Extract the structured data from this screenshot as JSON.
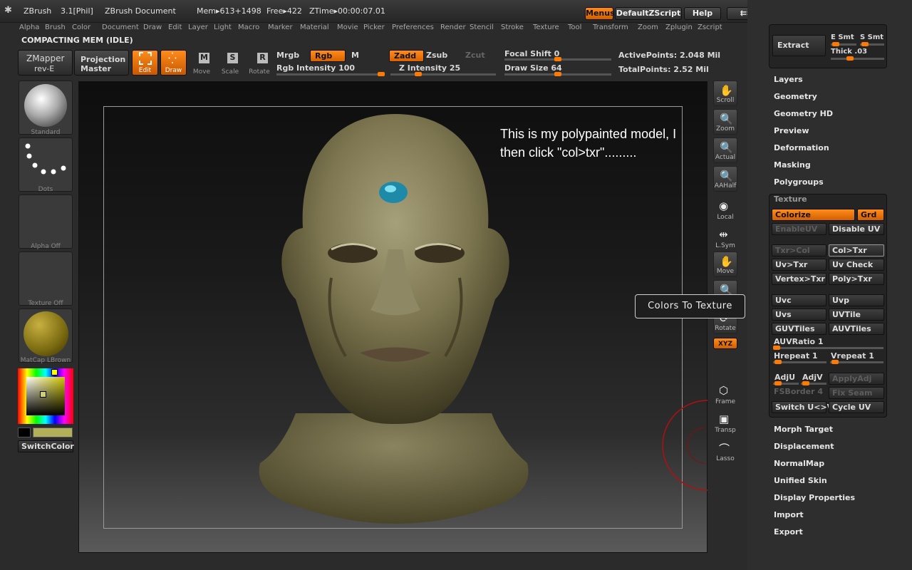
{
  "titlebar": {
    "app": "ZBrush",
    "version": "3.1[Phil]",
    "document": "ZBrush Document",
    "mem": "Mem▸613+1498",
    "free": "Free▸422",
    "ztime": "ZTime▸00:00:07.01",
    "menus_btn": "Menus",
    "script_btn": "DefaultZScript",
    "help_btn": "Help"
  },
  "menubar": [
    "Alpha",
    "Brush",
    "Color",
    "Document",
    "Draw",
    "Edit",
    "Layer",
    "Light",
    "Macro",
    "Marker",
    "Material",
    "Movie",
    "Picker",
    "Preferences",
    "Render",
    "Stencil",
    "Stroke",
    "Texture",
    "Tool",
    "Transform",
    "Zoom",
    "Zplugin",
    "Zscript"
  ],
  "status": "COMPACTING MEM (IDLE)",
  "toolbar": {
    "zmapper": "ZMapper",
    "zmapper_sub": "rev-E",
    "projection": "Projection",
    "projection_sub": "Master",
    "edit": "Edit",
    "draw": "Draw",
    "move": "Move",
    "scale": "Scale",
    "rotate": "Rotate",
    "mrgb": "Mrgb",
    "rgb": "Rgb",
    "m": "M",
    "rgb_intensity": "Rgb Intensity 100",
    "zadd": "Zadd",
    "zsub": "Zsub",
    "zcut": "Zcut",
    "z_intensity": "Z Intensity 25",
    "focal_shift": "Focal Shift 0",
    "draw_size": "Draw Size 64",
    "active_points": "ActivePoints: 2.048 Mil",
    "total_points": "TotalPoints: 2.52 Mil"
  },
  "leftpanel": {
    "standard": "Standard",
    "dots": "Dots",
    "alpha": "Alpha Off",
    "texture": "Texture Off",
    "matcap": "MatCap LBrown",
    "switchcolor": "SwitchColor"
  },
  "rightbar": [
    "Scroll",
    "Zoom",
    "Actual",
    "AAHalf",
    "Local",
    "L.Sym",
    "Move",
    "Scale",
    "Rotate",
    "XYZ",
    "Frame",
    "Transp",
    "Lasso"
  ],
  "tray_top": {
    "extract": "Extract",
    "e_smt": "E Smt",
    "s_smt": "S Smt",
    "thick": "Thick .03"
  },
  "tray_menu_top": [
    "Layers",
    "Geometry",
    "Geometry HD",
    "Preview",
    "Deformation",
    "Masking",
    "Polygroups"
  ],
  "texture_panel": {
    "title": "Texture",
    "colorize": "Colorize",
    "grd": "Grd",
    "enableuv": "EnableUV",
    "disableuv": "Disable UV",
    "txr_col": "Txr>Col",
    "col_txr": "Col>Txr",
    "uv_txr": "Uv>Txr",
    "uv_check": "Uv Check",
    "vertex_txr": "Vertex>Txr",
    "poly_txr": "Poly>Txr",
    "uvc": "Uvc",
    "uvp": "Uvp",
    "uvs": "Uvs",
    "uvtile": "UVTile",
    "guvtiles": "GUVTiles",
    "auvtiles": "AUVTiles",
    "auvratio": "AUVRatio 1",
    "hrepeat": "Hrepeat 1",
    "vrepeat": "Vrepeat 1",
    "adju": "AdjU",
    "adjv": "AdjV",
    "applyadj": "ApplyAdj",
    "fsborder": "FSBorder 4",
    "fixseam": "Fix Seam",
    "switch_uv": "Switch U<>V",
    "cycle_uv": "Cycle UV"
  },
  "tray_menu_bottom": [
    "Morph Target",
    "Displacement",
    "NormalMap",
    "Unified Skin",
    "Display Properties",
    "Import",
    "Export"
  ],
  "tooltip": "Colors To Texture",
  "note": "This is my polypainted model, I then click \"col>txr\".........",
  "colors": {
    "accent": "#ff7a00",
    "bg": "#2b2b2b",
    "skin": "#8c8660"
  }
}
